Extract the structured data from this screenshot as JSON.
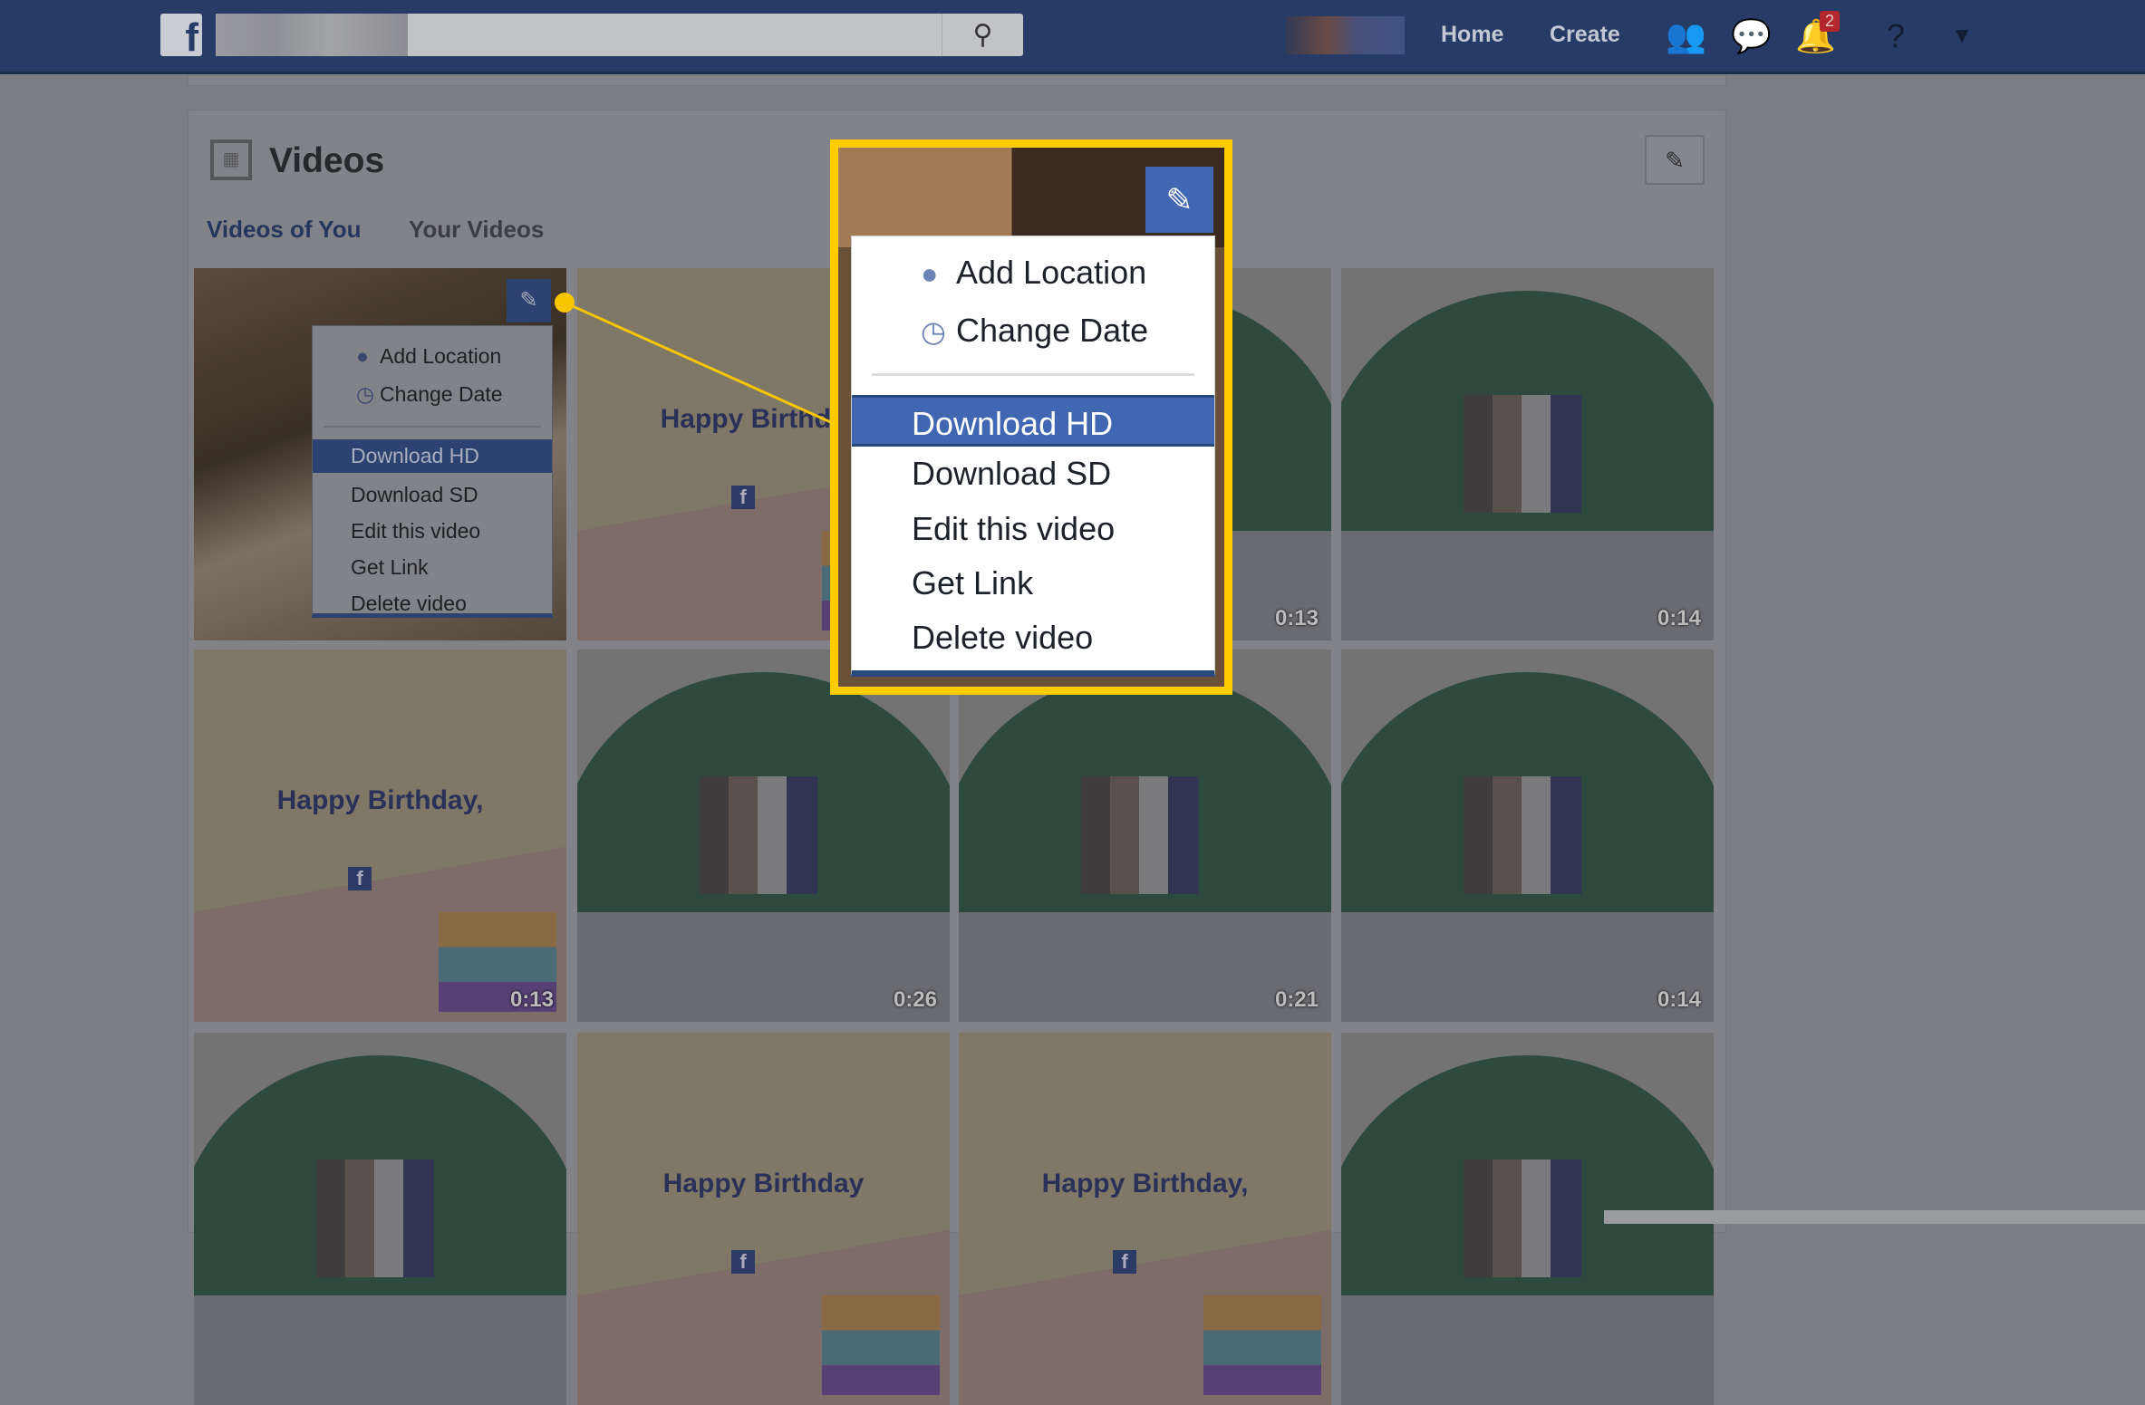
{
  "topbar": {
    "logo": "f",
    "search_icon": "search-icon",
    "home": "Home",
    "create": "Create",
    "notification_count": "2",
    "icons": [
      "friends-icon",
      "messenger-icon",
      "bell-icon",
      "help-icon",
      "caret-down-icon"
    ]
  },
  "section": {
    "title": "Videos",
    "edit_icon": "pencil-icon",
    "tabs": [
      "Videos of You",
      "Your Videos"
    ]
  },
  "tiles": [
    {
      "type": "bedroom",
      "duration": ""
    },
    {
      "type": "birthday",
      "text": "Happy Birthday,",
      "duration": ""
    },
    {
      "type": "hill",
      "duration": "0:13"
    },
    {
      "type": "hill",
      "duration": "0:14"
    },
    {
      "type": "birthday",
      "text": "Happy Birthday,",
      "duration": "0:13"
    },
    {
      "type": "hill",
      "duration": "0:26"
    },
    {
      "type": "hill",
      "duration": "0:21"
    },
    {
      "type": "hill",
      "duration": "0:14"
    },
    {
      "type": "hill",
      "duration": ""
    },
    {
      "type": "birthday",
      "text": "Happy Birthday",
      "duration": ""
    },
    {
      "type": "birthday",
      "text": "Happy Birthday,",
      "duration": ""
    },
    {
      "type": "hill",
      "duration": ""
    }
  ],
  "menu": {
    "add_location": "Add Location",
    "change_date": "Change Date",
    "download_hd": "Download HD",
    "download_sd": "Download SD",
    "edit": "Edit this video",
    "get_link": "Get Link",
    "delete": "Delete video"
  },
  "colors": {
    "highlight": "#4267b2",
    "callout": "#ffcc00"
  }
}
